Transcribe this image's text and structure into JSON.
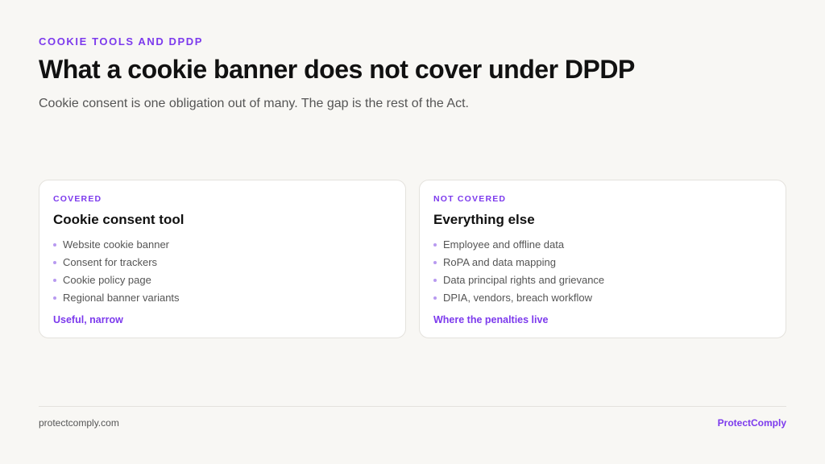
{
  "header": {
    "eyebrow": "COOKIE TOOLS AND DPDP",
    "title": "What a cookie banner does not cover under DPDP",
    "subtitle": "Cookie consent is one obligation out of many. The gap is the rest of the Act."
  },
  "cards": [
    {
      "tag": "COVERED",
      "title": "Cookie consent tool",
      "items": [
        "Website cookie banner",
        "Consent for trackers",
        "Cookie policy page",
        "Regional banner variants"
      ],
      "footer": "Useful, narrow"
    },
    {
      "tag": "NOT COVERED",
      "title": "Everything else",
      "items": [
        "Employee and offline data",
        "RoPA and data mapping",
        "Data principal rights and grievance",
        "DPIA, vendors, breach workflow"
      ],
      "footer": "Where the penalties live"
    }
  ],
  "footer": {
    "domain": "protectcomply.com",
    "brand": "ProtectComply"
  },
  "colors": {
    "accent": "#7c3aed",
    "background": "#f8f7f4",
    "card": "#ffffff",
    "bullet": "#b89af0"
  }
}
